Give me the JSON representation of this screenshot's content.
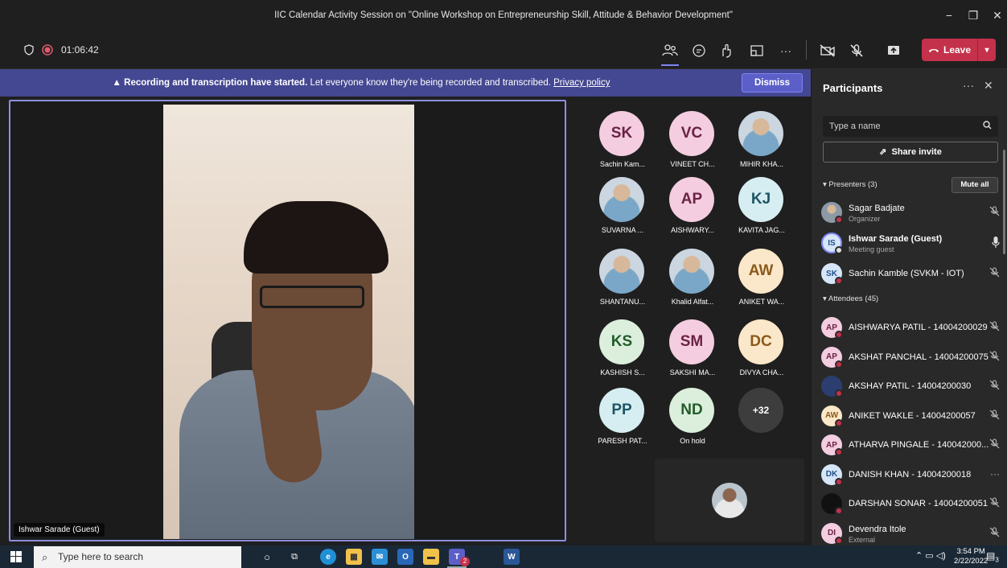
{
  "window": {
    "title": "IIC Calendar Activity Session on \"Online Workshop on Entrepreneurship Skill, Attitude & Behavior Development\"",
    "minimize": "−",
    "maximize": "❐",
    "close": "✕"
  },
  "toolbar": {
    "timer": "01:06:42",
    "leave_label": "Leave",
    "more": "···"
  },
  "banner": {
    "bold": "Recording and transcription have started.",
    "text": " Let everyone know they're being recorded and transcribed. ",
    "link": "Privacy policy",
    "dismiss": "Dismiss"
  },
  "stage": {
    "name": "Ishwar Sarade (Guest)"
  },
  "tiles": [
    {
      "initials": "SK",
      "name": "Sachin Kam...",
      "bg": "#f4cde0",
      "fg": "#6b2245"
    },
    {
      "initials": "VC",
      "name": "VINEET CH...",
      "bg": "#f4cde0",
      "fg": "#6b2245"
    },
    {
      "initials": "",
      "name": "MIHIR KHA...",
      "bg": "#b9c7d6",
      "fg": "#333"
    },
    {
      "initials": "",
      "name": "SUVARNA ...",
      "bg": "#c9d9c2",
      "fg": "#333"
    },
    {
      "initials": "AP",
      "name": "AISHWARY...",
      "bg": "#f4cde0",
      "fg": "#6b2245"
    },
    {
      "initials": "KJ",
      "name": "KAVITA JAG...",
      "bg": "#d6eef2",
      "fg": "#1f5565"
    },
    {
      "initials": "",
      "name": "SHANTANU...",
      "bg": "#dfe6ea",
      "fg": "#333"
    },
    {
      "initials": "",
      "name": "Khalid Alfat...",
      "bg": "#cfd2c6",
      "fg": "#333"
    },
    {
      "initials": "AW",
      "name": "ANIKET WA...",
      "bg": "#fbe7c9",
      "fg": "#8a5a1c"
    },
    {
      "initials": "KS",
      "name": "KASHISH S...",
      "bg": "#dbefdc",
      "fg": "#235c2a"
    },
    {
      "initials": "SM",
      "name": "SAKSHI MA...",
      "bg": "#f4cde0",
      "fg": "#6b2245"
    },
    {
      "initials": "DC",
      "name": "DIVYA CHA...",
      "bg": "#fbe7c9",
      "fg": "#8a5a1c"
    },
    {
      "initials": "PP",
      "name": "PARESH PAT...",
      "bg": "#d6eef2",
      "fg": "#1f5565"
    },
    {
      "initials": "ND",
      "name": "On hold",
      "bg": "#dbefdc",
      "fg": "#235c2a"
    },
    {
      "initials": "+32",
      "name": "",
      "bg": "#3d3d3d",
      "fg": "#ffffff"
    }
  ],
  "panel": {
    "title": "Participants",
    "search_placeholder": "Type a name",
    "share_invite": "Share invite",
    "presenters_label": "Presenters (3)",
    "mute_all": "Mute all",
    "attendees_label": "Attendees (45)",
    "presenters": [
      {
        "initials": "",
        "name": "Sagar Badjate",
        "role": "Organizer",
        "mic": "muted"
      },
      {
        "initials": "IS",
        "name": "Ishwar Sarade (Guest)",
        "role": "Meeting guest",
        "mic": "on"
      },
      {
        "initials": "SK",
        "name": "Sachin Kamble (SVKM - IOT)",
        "role": "",
        "mic": "muted"
      }
    ],
    "attendees": [
      {
        "initials": "AP",
        "name": "AISHWARYA PATIL - 14004200029",
        "role": "",
        "mic": "muted",
        "bg": "#f4cde0",
        "fg": "#6b2245"
      },
      {
        "initials": "AP",
        "name": "AKSHAT PANCHAL - 14004200075",
        "role": "",
        "mic": "muted",
        "bg": "#f4cde0",
        "fg": "#6b2245"
      },
      {
        "initials": "",
        "name": "AKSHAY PATIL - 14004200030",
        "role": "",
        "mic": "muted",
        "bg": "#2c3e70",
        "fg": "#fff"
      },
      {
        "initials": "AW",
        "name": "ANIKET WAKLE - 14004200057",
        "role": "",
        "mic": "muted",
        "bg": "#fbe7c9",
        "fg": "#8a5a1c"
      },
      {
        "initials": "AP",
        "name": "ATHARVA PINGALE - 140042000...",
        "role": "",
        "mic": "muted",
        "bg": "#f4cde0",
        "fg": "#6b2245"
      },
      {
        "initials": "DK",
        "name": "DANISH KHAN - 14004200018",
        "role": "",
        "mic": "more",
        "bg": "#d6e6f8",
        "fg": "#1f4f8a"
      },
      {
        "initials": "",
        "name": "DARSHAN SONAR - 14004200051",
        "role": "",
        "mic": "muted",
        "bg": "#111",
        "fg": "#fff"
      },
      {
        "initials": "DI",
        "name": "Devendra Itole",
        "role": "External",
        "mic": "muted",
        "bg": "#f4cde0",
        "fg": "#6b2245"
      }
    ]
  },
  "taskbar": {
    "search_placeholder": "Type here to search",
    "time": "3:54 PM",
    "date": "2/22/2022",
    "teams_badge": "2",
    "notif_count": "3"
  }
}
